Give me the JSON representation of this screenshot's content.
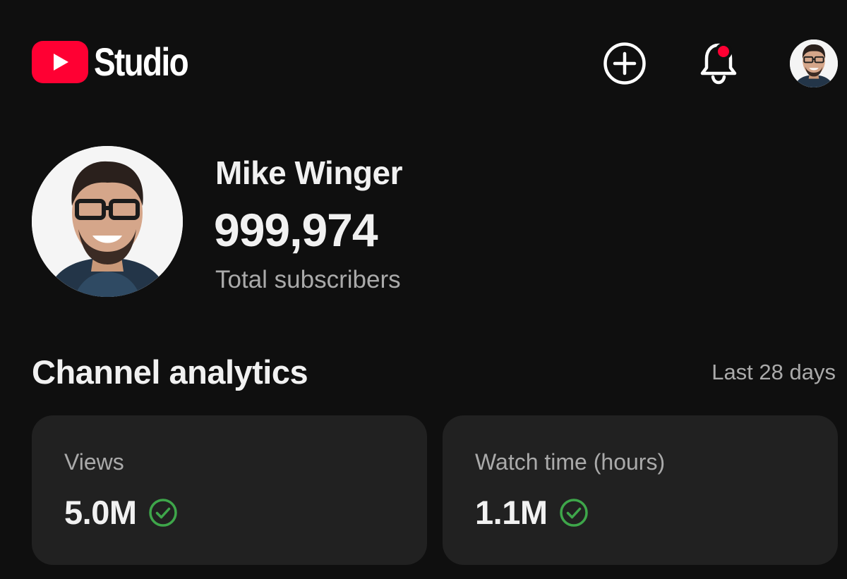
{
  "header": {
    "app_name": "Studio",
    "create_icon": "plus-circle-icon",
    "notification_icon": "bell-icon",
    "notification_badge_color": "#ff0033",
    "account_icon": "avatar"
  },
  "channel": {
    "name": "Mike Winger",
    "subscriber_count": "999,974",
    "subscriber_label": "Total subscribers"
  },
  "analytics": {
    "title": "Channel analytics",
    "period": "Last 28 days",
    "cards": [
      {
        "label": "Views",
        "value": "5.0M",
        "status_icon": "check-circle-icon",
        "status_color": "#3ea64a"
      },
      {
        "label": "Watch time (hours)",
        "value": "1.1M",
        "status_icon": "check-circle-icon",
        "status_color": "#3ea64a"
      }
    ]
  },
  "colors": {
    "background": "#0f0f0f",
    "card": "#212121",
    "brand_red": "#ff0033",
    "secondary_text": "#aaaaaa"
  }
}
